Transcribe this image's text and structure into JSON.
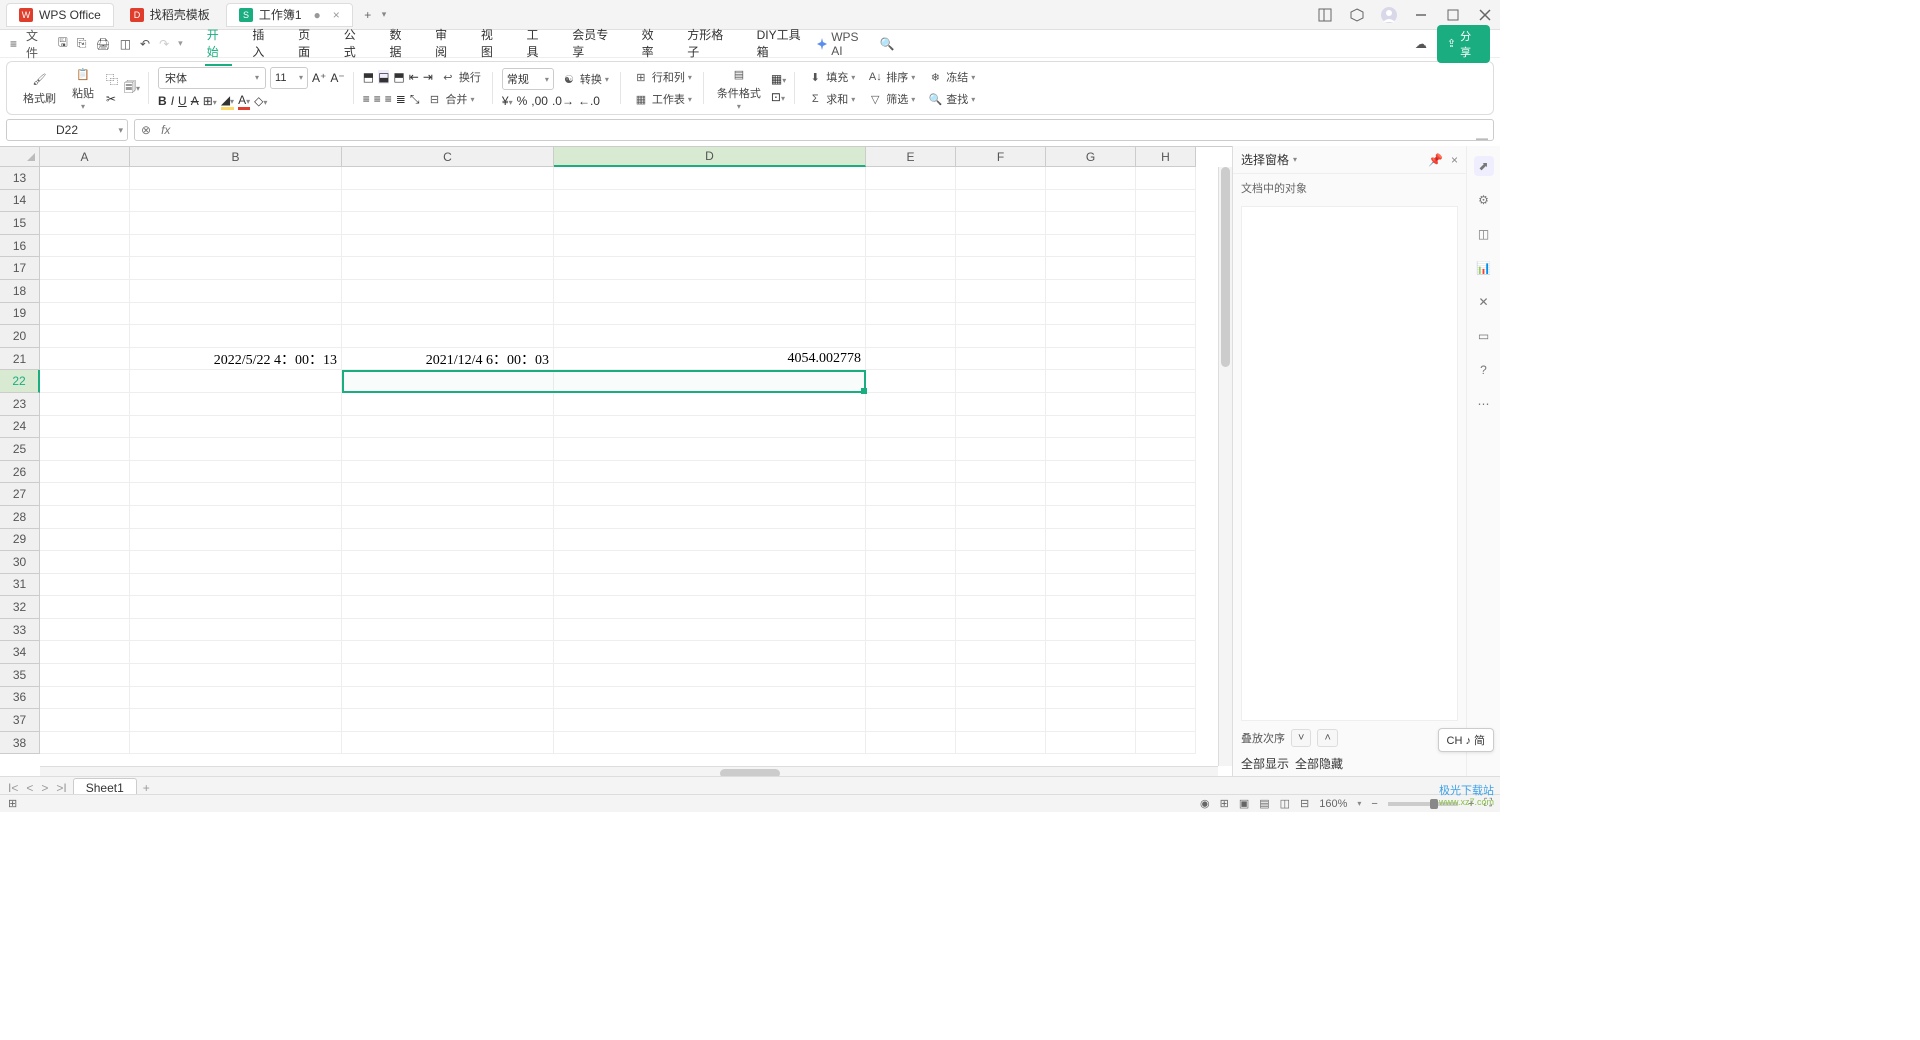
{
  "titlebar": {
    "tabs": [
      {
        "label": "WPS Office",
        "icon_color": "#e03e2d"
      },
      {
        "label": "找稻壳模板",
        "icon_color": "#e03e2d"
      },
      {
        "label": "工作簿1",
        "icon_color": "#1aad7f",
        "mod": "●"
      }
    ],
    "add": "+"
  },
  "menubar": {
    "file": "文件",
    "tabs": [
      "开始",
      "插入",
      "页面",
      "公式",
      "数据",
      "审阅",
      "视图",
      "工具",
      "会员专享",
      "效率",
      "方形格子",
      "DIY工具箱"
    ],
    "ai": "WPS AI",
    "share": "分享"
  },
  "ribbon": {
    "format_brush": "格式刷",
    "paste": "粘贴",
    "font_name": "宋体",
    "font_size": "11",
    "wrap": "换行",
    "number_format": "常规",
    "convert": "转换",
    "merge": "合并",
    "row_col": "行和列",
    "worksheet": "工作表",
    "cond_fmt": "条件格式",
    "fill": "填充",
    "sort": "排序",
    "freeze": "冻结",
    "sum": "求和",
    "filter": "筛选",
    "find": "查找"
  },
  "namebox": "D22",
  "fx": "fx",
  "columns": {
    "A": 90,
    "B": 212,
    "C": 212,
    "D": 312,
    "E": 90,
    "F": 90,
    "G": 90,
    "H": 60
  },
  "colhead_selected": "D",
  "rows_start": 13,
  "rows_end": 38,
  "row_selected": 22,
  "cells": {
    "B21": "2022/5/22 4：00：13",
    "C21": "2021/12/4 6：00：03",
    "D21": "4054.002778"
  },
  "selection": {
    "col": "D",
    "row": 22
  },
  "sheet": {
    "name": "Sheet1"
  },
  "rpanel": {
    "title": "选择窗格",
    "subtitle": "文档中的对象",
    "order": "叠放次序",
    "show_all": "全部显示",
    "hide_all": "全部隐藏"
  },
  "status": {
    "zoom": "160%",
    "ime": "CH ♪ 简"
  },
  "watermark": {
    "line1": "极光下载站",
    "line2": "www.xz7.com"
  }
}
